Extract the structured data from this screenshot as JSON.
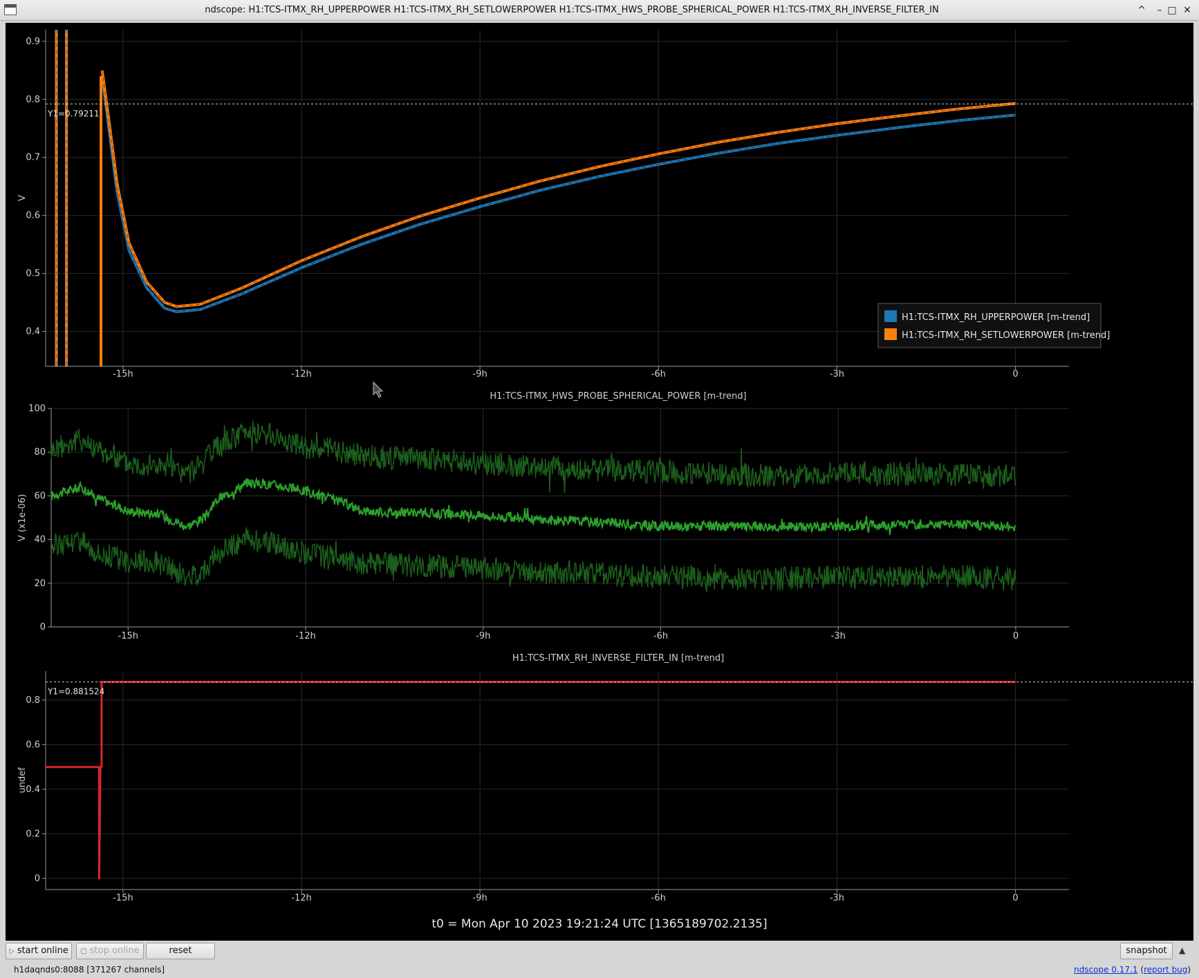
{
  "window": {
    "title": "ndscope: H1:TCS-ITMX_RH_UPPERPOWER H1:TCS-ITMX_RH_SETLOWERPOWER H1:TCS-ITMX_HWS_PROBE_SPHERICAL_POWER H1:TCS-ITMX_RH_INVERSE_FILTER_IN",
    "controls": [
      "^",
      "–",
      "□",
      "✕"
    ]
  },
  "t0_label": "t0 = Mon Apr 10 2023 19:21:24 UTC [1365189702.2135]",
  "toolbar": {
    "start_online": "start online",
    "stop_online": "stop online",
    "reset": "reset",
    "snapshot": "snapshot",
    "expand_icon": "▲"
  },
  "status": {
    "server": "h1daqnds0:8088  [371267 channels]",
    "version": "ndscope 0.17.1",
    "report_bug": "report bug"
  },
  "colors": {
    "upperpower": "#1f77b4",
    "setlowerpower": "#ff7f0e",
    "spherical_mean": "#2ca02c",
    "spherical_minmax": "#1c5f1c",
    "inverse_filter": "#d62728",
    "grid": "#2a2a2a",
    "axis": "#9a9a9a"
  },
  "chart_data": [
    {
      "type": "line",
      "title": "",
      "xlabel": "",
      "ylabel": "V",
      "xlim": [
        -16.3,
        0.9
      ],
      "ylim": [
        0.34,
        0.92
      ],
      "x_ticks": [
        -15,
        -12,
        -9,
        -6,
        -3,
        0
      ],
      "x_tick_labels": [
        "-15h",
        "-12h",
        "-9h",
        "-6h",
        "-3h",
        "0"
      ],
      "y_ticks": [
        0.4,
        0.5,
        0.6,
        0.7,
        0.8,
        0.9
      ],
      "y_tick_labels": [
        "0.4",
        "0.5",
        "0.6",
        "0.7",
        "0.8",
        "0.9"
      ],
      "cursor": {
        "y": 0.79211,
        "label": "Y1=0.79211"
      },
      "legend": {
        "placement": "right",
        "entries": [
          "H1:TCS-ITMX_RH_UPPERPOWER [m-trend]",
          "H1:TCS-ITMX_RH_SETLOWERPOWER [m-trend]"
        ]
      },
      "series": [
        {
          "name": "H1:TCS-ITMX_RH_UPPERPOWER [m-trend]",
          "color": "#1f77b4",
          "x": [
            -15.35,
            -15.25,
            -15.1,
            -14.9,
            -14.6,
            -14.3,
            -14.1,
            -13.7,
            -13.0,
            -12.0,
            -11.0,
            -10.0,
            -9.0,
            -8.0,
            -7.0,
            -6.0,
            -5.0,
            -4.0,
            -3.0,
            -2.0,
            -1.0,
            0.0
          ],
          "y": [
            0.84,
            0.76,
            0.64,
            0.54,
            0.475,
            0.44,
            0.434,
            0.438,
            0.465,
            0.51,
            0.55,
            0.585,
            0.615,
            0.643,
            0.667,
            0.688,
            0.707,
            0.724,
            0.738,
            0.751,
            0.763,
            0.773
          ]
        },
        {
          "name": "H1:TCS-ITMX_RH_SETLOWERPOWER [m-trend]",
          "color": "#ff7f0e",
          "x": [
            -15.35,
            -15.25,
            -15.1,
            -14.9,
            -14.6,
            -14.3,
            -14.1,
            -13.7,
            -13.0,
            -12.0,
            -11.0,
            -10.0,
            -9.0,
            -8.0,
            -7.0,
            -6.0,
            -5.0,
            -4.0,
            -3.0,
            -2.0,
            -1.0,
            0.0
          ],
          "y": [
            0.85,
            0.775,
            0.655,
            0.553,
            0.485,
            0.45,
            0.443,
            0.447,
            0.475,
            0.522,
            0.563,
            0.599,
            0.63,
            0.659,
            0.684,
            0.706,
            0.726,
            0.743,
            0.758,
            0.771,
            0.783,
            0.793
          ]
        }
      ]
    },
    {
      "type": "line",
      "title": "H1:TCS-ITMX_HWS_PROBE_SPHERICAL_POWER [m-trend]",
      "xlabel": "",
      "ylabel": "V (x1e-06)",
      "xlim": [
        -16.3,
        0.9
      ],
      "ylim": [
        0,
        100
      ],
      "x_ticks": [
        -15,
        -12,
        -9,
        -6,
        -3,
        0
      ],
      "x_tick_labels": [
        "-15h",
        "-12h",
        "-9h",
        "-6h",
        "-3h",
        "0"
      ],
      "y_ticks": [
        0,
        20,
        40,
        60,
        80,
        100
      ],
      "y_tick_labels": [
        "0",
        "20",
        "40",
        "60",
        "80",
        "100"
      ],
      "series": [
        {
          "color": "#2ca02c",
          "x": [
            -16.3,
            -15.8,
            -15.5,
            -15.0,
            -14.5,
            -14.0,
            -13.7,
            -13.5,
            -13.0,
            -12.5,
            -12.0,
            -11.5,
            -11.0,
            -10.0,
            -9.0,
            -8.0,
            -7.0,
            -6.0,
            -5.0,
            -4.0,
            -3.0,
            -2.0,
            -1.0,
            0.0
          ],
          "y": [
            60,
            64,
            59,
            53,
            52,
            46,
            50,
            58,
            66,
            65,
            62,
            58,
            53,
            52,
            51,
            49,
            48,
            46,
            46,
            46,
            46,
            47,
            47,
            46
          ]
        },
        {
          "color": "#1c5f1c",
          "x": [
            -16.3,
            -15.8,
            -15.5,
            -15.0,
            -14.5,
            -14.0,
            -13.7,
            -13.5,
            -13.0,
            -12.5,
            -12.0,
            -11.5,
            -11.0,
            -10.0,
            -9.0,
            -8.0,
            -7.0,
            -6.0,
            -5.0,
            -4.0,
            -3.0,
            -2.0,
            -1.0,
            0.0
          ],
          "y": [
            81,
            86,
            81,
            75,
            74,
            70,
            76,
            82,
            90,
            87,
            82,
            81,
            78,
            77,
            75,
            73,
            72,
            71,
            70,
            69,
            70,
            70,
            70,
            69
          ]
        },
        {
          "color": "#1c5f1c",
          "x": [
            -16.3,
            -15.8,
            -15.5,
            -15.0,
            -14.5,
            -14.0,
            -13.7,
            -13.5,
            -13.0,
            -12.5,
            -12.0,
            -11.5,
            -11.0,
            -10.0,
            -9.0,
            -8.0,
            -7.0,
            -6.0,
            -5.0,
            -4.0,
            -3.0,
            -2.0,
            -1.0,
            0.0
          ],
          "y": [
            37,
            40,
            34,
            30,
            30,
            22,
            27,
            33,
            41,
            38,
            34,
            31,
            29,
            28,
            27,
            25,
            24,
            23,
            22,
            22,
            23,
            23,
            23,
            22
          ]
        }
      ]
    },
    {
      "type": "line",
      "title": "H1:TCS-ITMX_RH_INVERSE_FILTER_IN [m-trend]",
      "xlabel": "",
      "ylabel": "undef",
      "xlim": [
        -16.3,
        0.9
      ],
      "ylim": [
        -0.05,
        0.93
      ],
      "x_ticks": [
        -15,
        -12,
        -9,
        -6,
        -3,
        0
      ],
      "x_tick_labels": [
        "-15h",
        "-12h",
        "-9h",
        "-6h",
        "-3h",
        "0"
      ],
      "y_ticks": [
        0,
        0.2,
        0.4,
        0.6,
        0.8
      ],
      "y_tick_labels": [
        "0",
        "0.2",
        "0.4",
        "0.6",
        "0.8"
      ],
      "cursor": {
        "y": 0.881524,
        "label": "Y1=0.881524"
      },
      "series": [
        {
          "color": "#d62728",
          "x": [
            -16.3,
            -15.4,
            -15.4,
            -15.38,
            -15.36,
            -15.36,
            0.0
          ],
          "y": [
            0.5,
            0.5,
            0.0,
            0.5,
            0.5,
            0.881524,
            0.881524
          ]
        }
      ]
    }
  ]
}
